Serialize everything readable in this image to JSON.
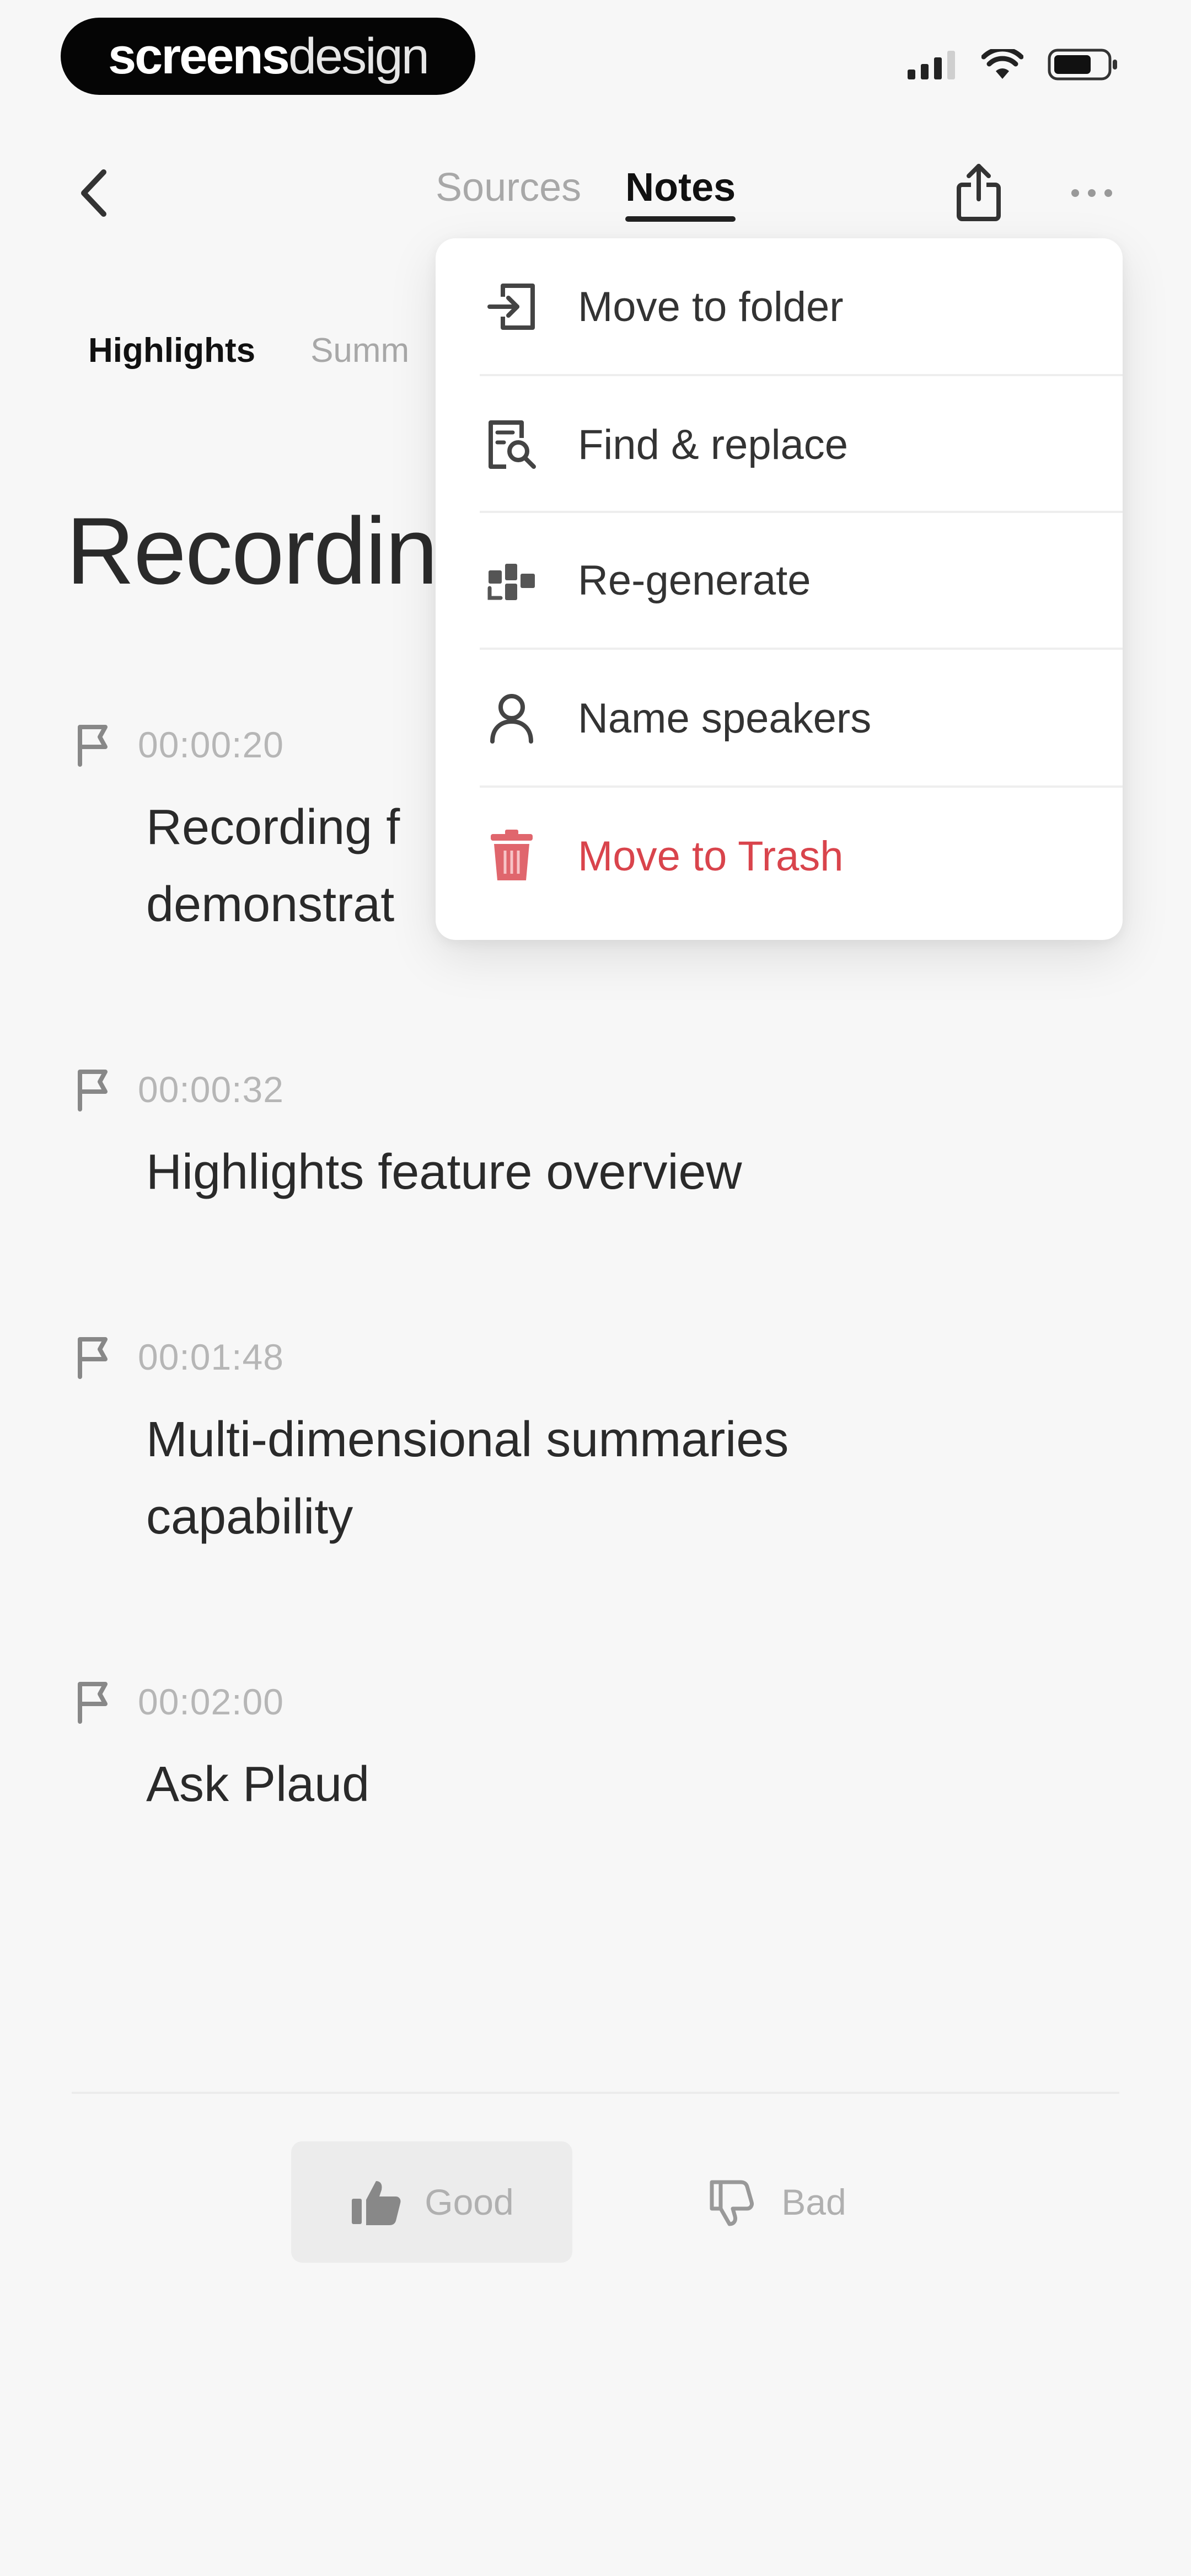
{
  "status_bar": {
    "brand_bold": "screens",
    "brand_light": "design",
    "icons": [
      "cellular-signal-icon",
      "wifi-icon",
      "battery-icon"
    ]
  },
  "nav": {
    "back_icon": "chevron-left-icon",
    "tabs": [
      {
        "label": "Sources",
        "active": false
      },
      {
        "label": "Notes",
        "active": true
      }
    ],
    "share_icon": "share-icon",
    "more_icon": "more-horizontal-icon"
  },
  "sub_tabs": [
    {
      "label": "Highlights",
      "active": true
    },
    {
      "label": "Summ",
      "active": false
    }
  ],
  "page_title": "Recordin",
  "highlights": [
    {
      "time": "00:00:20",
      "text": "Recording f demonstrat"
    },
    {
      "time": "00:00:32",
      "text": "Highlights feature overview"
    },
    {
      "time": "00:01:48",
      "text": "Multi-dimensional summaries capability"
    },
    {
      "time": "00:02:00",
      "text": "Ask Plaud"
    }
  ],
  "feedback": {
    "good_label": "Good",
    "bad_label": "Bad"
  },
  "menu": {
    "items": [
      {
        "label": "Move to folder",
        "icon": "move-to-folder-icon",
        "danger": false
      },
      {
        "label": "Find & replace",
        "icon": "find-replace-icon",
        "danger": false
      },
      {
        "label": "Re-generate",
        "icon": "regenerate-icon",
        "danger": false
      },
      {
        "label": "Name speakers",
        "icon": "person-icon",
        "danger": false
      },
      {
        "label": "Move to Trash",
        "icon": "trash-icon",
        "danger": true
      }
    ]
  },
  "colors": {
    "background": "#f7f7f7",
    "danger": "#d9444c",
    "muted": "#a8a8a8",
    "text": "#2a2a2a"
  }
}
